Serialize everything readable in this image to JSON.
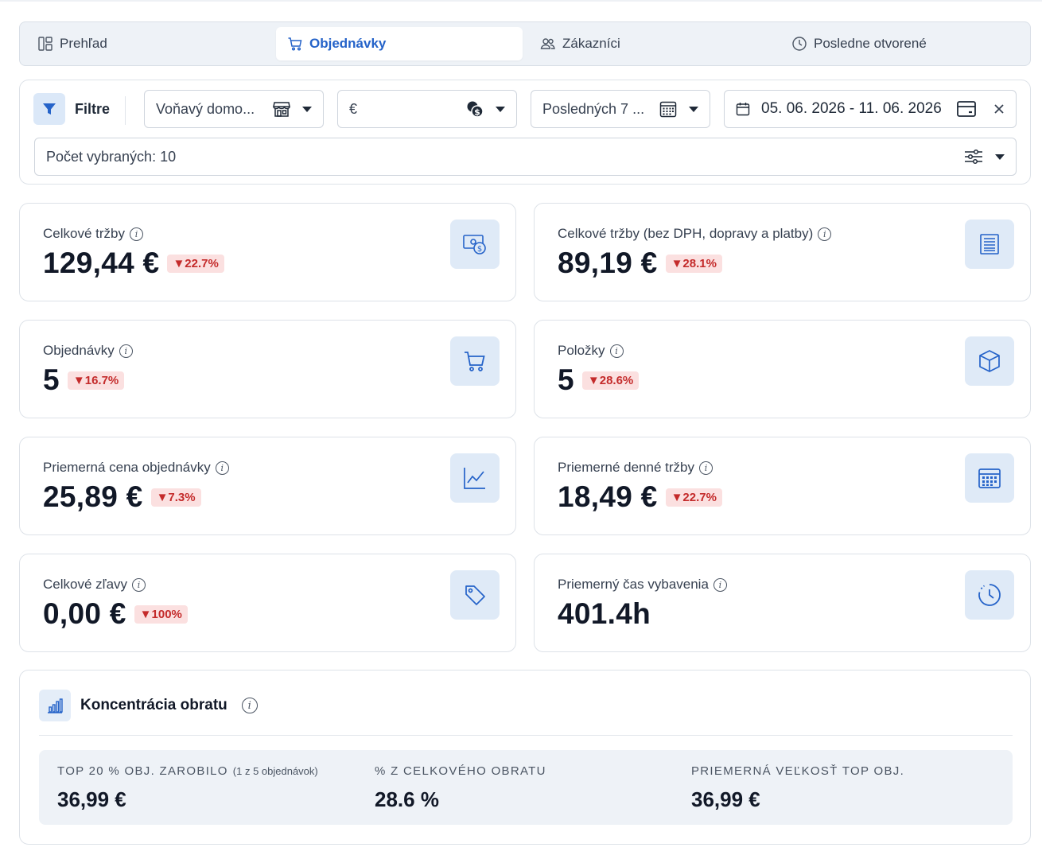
{
  "tabs": [
    {
      "label": "Prehľad",
      "icon": "layout-icon"
    },
    {
      "label": "Objednávky",
      "icon": "cart-icon",
      "active": true
    },
    {
      "label": "Zákazníci",
      "icon": "users-icon"
    },
    {
      "label": "Posledne otvorené",
      "icon": "clock-icon"
    }
  ],
  "filters": {
    "title": "Filtre",
    "store": "Voňavý domo...",
    "currency": "€",
    "period": "Posledných 7 ...",
    "date_range": "05. 06. 2026 - 11. 06. 2026",
    "selected_count": "Počet vybraných: 10"
  },
  "kpis": [
    {
      "label": "Celkové tržby",
      "value": "129,44 €",
      "change": "▼22.7%",
      "icon": "money-icon"
    },
    {
      "label": "Celkové tržby (bez DPH, dopravy a platby)",
      "value": "89,19 €",
      "change": "▼28.1%",
      "icon": "receipt-icon"
    },
    {
      "label": "Objednávky",
      "value": "5",
      "change": "▼16.7%",
      "icon": "cart-icon"
    },
    {
      "label": "Položky",
      "value": "5",
      "change": "▼28.6%",
      "icon": "box-icon"
    },
    {
      "label": "Priemerná cena objednávky",
      "value": "25,89 €",
      "change": "▼7.3%",
      "icon": "line-chart-icon"
    },
    {
      "label": "Priemerné denné tržby",
      "value": "18,49 €",
      "change": "▼22.7%",
      "icon": "calendar-icon"
    },
    {
      "label": "Celkové zľavy",
      "value": "0,00 €",
      "change": "▼100%",
      "icon": "tag-icon"
    },
    {
      "label": "Priemerný čas vybavenia",
      "value": "401.4h",
      "change": "",
      "icon": "clock-icon"
    }
  ],
  "concentration": {
    "title": "Koncentrácia obratu",
    "stats": [
      {
        "label": "TOP 20 % OBJ. ZAROBILO",
        "sub": "(1 z 5 objednávok)",
        "value": "36,99 €"
      },
      {
        "label": "% Z CELKOVÉHO OBRATU",
        "sub": "",
        "value": "28.6 %"
      },
      {
        "label": "PRIEMERNÁ VEĽKOSŤ TOP OBJ.",
        "sub": "",
        "value": "36,99 €"
      }
    ]
  },
  "colors": {
    "accent": "#2563c9",
    "negative": "#c42b2b",
    "negative_bg": "#fbe0e0",
    "icon_bg": "#dfeaf7"
  }
}
